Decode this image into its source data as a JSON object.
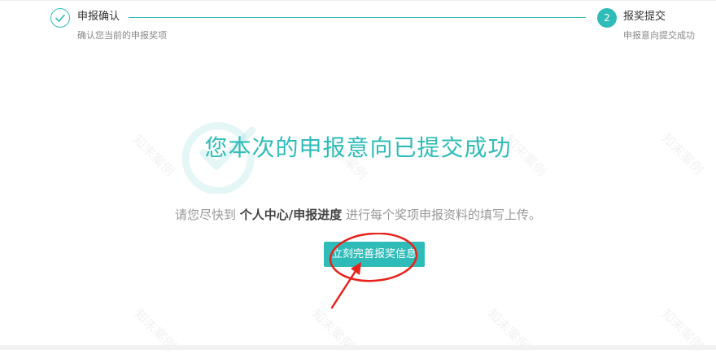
{
  "steps": [
    {
      "index": "1",
      "title": "申报确认",
      "desc": "确认您当前的申报奖项",
      "status": "done",
      "icon": "check-icon"
    },
    {
      "index": "2",
      "title": "报奖提交",
      "desc": "申报意向提交成功",
      "status": "active"
    }
  ],
  "result": {
    "title": "您本次的申报意向已提交成功",
    "hint_before": "请您尽快到 ",
    "hint_link": "个人中心/申报进度",
    "hint_after": " 进行每个奖项申报资料的填写上传。",
    "button_label": "立刻完善报奖信息"
  },
  "watermark": {
    "text": "知末案例"
  },
  "colors": {
    "accent": "#2fbcb8",
    "annotation": "#e8221b"
  }
}
